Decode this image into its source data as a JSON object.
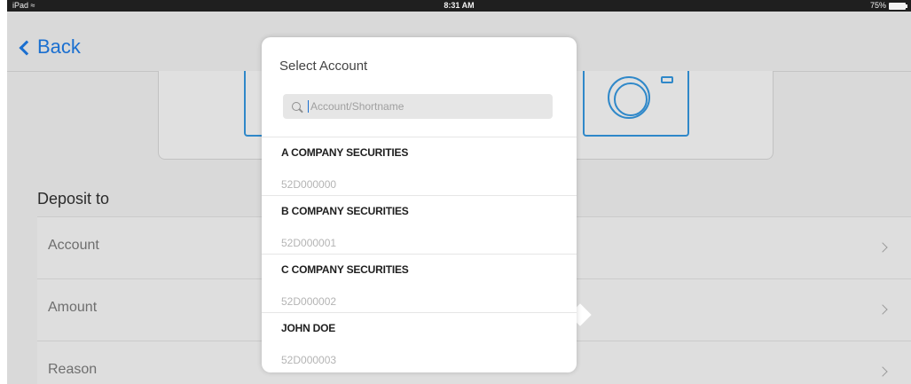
{
  "status_bar": {
    "device": "iPad",
    "time": "8:31 AM",
    "battery": "75%"
  },
  "nav": {
    "back_label": "Back"
  },
  "deposit": {
    "section_title": "Deposit to",
    "rows": [
      {
        "label": "Account"
      },
      {
        "label": "Amount"
      },
      {
        "label": "Reason"
      }
    ]
  },
  "popover": {
    "title": "Select Account",
    "search_placeholder": "Account/Shortname",
    "accounts": [
      {
        "name": "A COMPANY SECURITIES",
        "code": "52D000000"
      },
      {
        "name": "B COMPANY SECURITIES",
        "code": "52D000001"
      },
      {
        "name": "C COMPANY SECURITIES",
        "code": "52D000002"
      },
      {
        "name": "JOHN DOE",
        "code": "52D000003"
      }
    ]
  },
  "colors": {
    "accent": "#1a6fd0",
    "camera_outline": "#2f88c9",
    "background": "#d9d9d9"
  }
}
